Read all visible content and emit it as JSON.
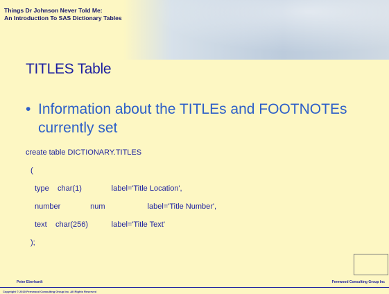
{
  "header": {
    "title_line1": "Things Dr Johnson Never Told Me:",
    "title_line2": "An Introduction To SAS Dictionary Tables"
  },
  "slide": {
    "title": "TITLES Table",
    "bullet": "Information about the TITLEs and FOOTNOTEs currently set",
    "code_lines": [
      "create table DICTIONARY.TITLES",
      "(",
      "type    char(1)              label='Title Location',",
      "number              num                    label='Title Number',",
      "text    char(256)           label='Title Text'",
      ");"
    ]
  },
  "footer": {
    "author": "Peter Eberhardt",
    "company": "Fernwood Consulting Group Inc",
    "copyright": "Copyright © 2010 Fernwood Consulting Group Inc. All Rights Reserved"
  },
  "icons": {
    "lighthouse": "lighthouse-icon"
  },
  "colors": {
    "background": "#fdf7c3",
    "title": "#1c1fa0",
    "bullet": "#2d5fc8",
    "banner": "#bccbdc"
  }
}
